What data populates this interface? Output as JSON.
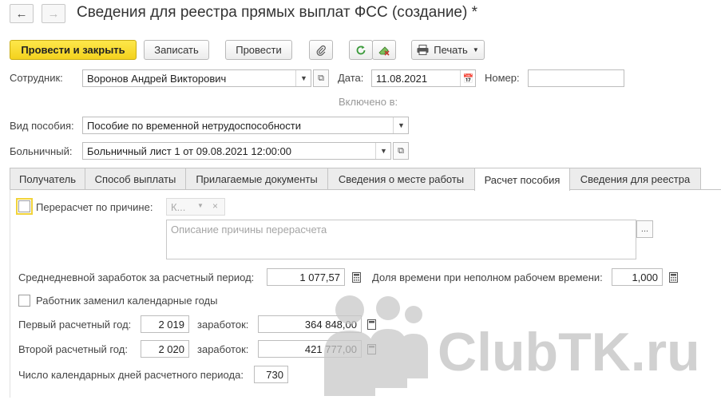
{
  "window": {
    "title": "Сведения для реестра прямых выплат ФСС (создание) *",
    "nav_back_icon": "arrow-left-icon",
    "nav_forward_icon": "arrow-right-icon"
  },
  "toolbar": {
    "post_and_close": "Провести и закрыть",
    "save": "Записать",
    "post": "Провести",
    "print": "Печать"
  },
  "form": {
    "employee_label": "Сотрудник:",
    "employee_value": "Воронов Андрей Викторович",
    "date_label": "Дата:",
    "date_value": "11.08.2021",
    "number_label": "Номер:",
    "number_value": "",
    "included_in_label": "Включено в:",
    "benefit_type_label": "Вид пособия:",
    "benefit_type_value": "Пособие по временной нетрудоспособности",
    "sick_leave_label": "Больничный:",
    "sick_leave_value": "Больничный лист 1 от 09.08.2021 12:00:00"
  },
  "tabs": [
    {
      "label": "Получатель"
    },
    {
      "label": "Способ выплаты"
    },
    {
      "label": "Прилагаемые документы"
    },
    {
      "label": "Сведения о месте работы"
    },
    {
      "label": "Расчет пособия",
      "active": true
    },
    {
      "label": "Сведения для реестра"
    }
  ],
  "calc_tab": {
    "recalc_label": "Перерасчет по причине:",
    "recalc_checked": false,
    "reason_value": "К...",
    "reason_placeholder": "Описание причины перерасчета",
    "more_button": "...",
    "avg_daily_label": "Среднедневной заработок за расчетный период:",
    "avg_daily_value": "1 077,57",
    "parttime_label": "Доля времени при неполном рабочем времени:",
    "parttime_value": "1,000",
    "replaced_years_label": "Работник заменил календарные годы",
    "replaced_years_checked": false,
    "year1_label": "Первый расчетный год:",
    "year1_value": "2 019",
    "year1_earnings_label": "заработок:",
    "year1_earnings_value": "364 848,00",
    "year2_label": "Второй расчетный год:",
    "year2_value": "2 020",
    "year2_earnings_label": "заработок:",
    "year2_earnings_value": "421 777,00",
    "days_label": "Число календарных дней расчетного периода:",
    "days_value": "730"
  },
  "watermark": {
    "text": "ClubTK.ru"
  },
  "colors": {
    "primary_button": "#f4d21e",
    "refresh_icon": "#3a9a3a",
    "clear_icon": "#c0392b"
  }
}
